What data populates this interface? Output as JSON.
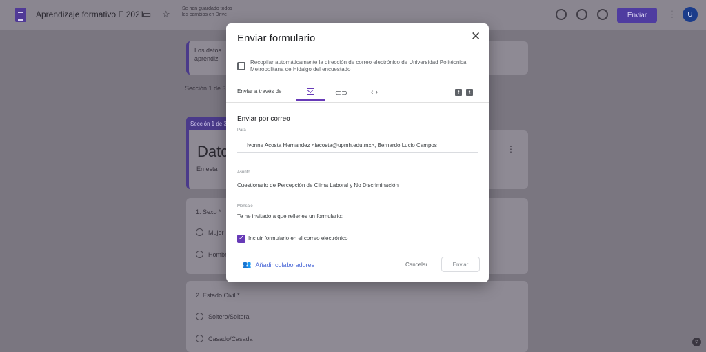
{
  "app": {
    "doc_title": "Aprendizaje formativo E 2021",
    "save_status": "Se han guardado todos los cambios en Drive",
    "send_label": "Enviar",
    "avatar_initial": "U"
  },
  "background": {
    "card1_lines": [
      "Los datos",
      "aprendiz"
    ],
    "section_text": "Sección 1 de 3",
    "section_tab": "Sección 1 de 3",
    "title_fragment": "Datc",
    "desc_fragment": "En esta",
    "q1_label": "1. Sexo *",
    "q1_options": [
      "Mujer",
      "Hombre"
    ],
    "q2_label": "2. Estado Civil *",
    "q2_options": [
      "Soltero/Soltera",
      "Casado/Casada"
    ]
  },
  "dialog": {
    "title": "Enviar formulario",
    "collect_label": "Recopilar automáticamente la dirección de correo electrónico de Universidad Politécnica Metropolitana de Hidalgo del encuestado",
    "send_via_label": "Enviar a través de",
    "tab_link": "⊂⊃",
    "tab_embed": "‹ ›",
    "social_facebook": "f",
    "social_twitter": "t",
    "email_section": "Enviar por correo",
    "to_label": "Para",
    "to_value": "Ivonne Acosta Hernandez <iacosta@upmh.edu.mx>, Bernardo Lucio Campos",
    "subject_label": "Asunto",
    "subject_value": "Cuestionario de Percepción de Clima Laboral y No Discriminación",
    "message_label": "Mensaje",
    "message_value": "Te he invitado a que rellenes un formulario:",
    "include_label": "Incluir formulario en el correo electrónico",
    "add_collaborators": "Añadir colaboradores",
    "cancel": "Cancelar",
    "send": "Enviar"
  },
  "colors": {
    "accent": "#673ab7",
    "link": "#4e6bd8",
    "header_button": "#4f3ca0"
  },
  "icons": {
    "close": "close-icon",
    "email": "email-icon",
    "link": "link-icon",
    "embed": "embed-icon",
    "add_people": "add-people-icon"
  }
}
